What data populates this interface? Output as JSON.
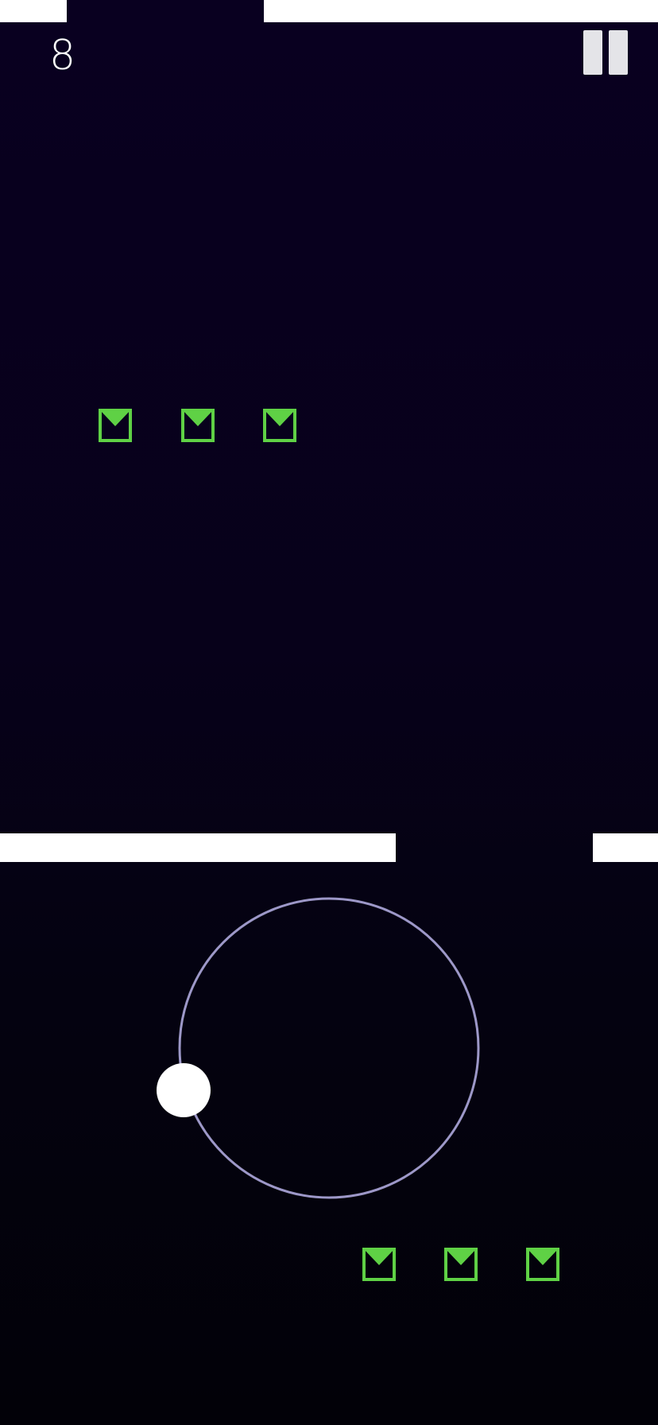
{
  "hud": {
    "score": "8",
    "pause_icon": "pause-icon"
  },
  "colors": {
    "background_top": "#090020",
    "background_bottom": "#020108",
    "wall": "#ffffff",
    "coin": "#5fd145",
    "orbit": "#9d98c8",
    "ball": "#ffffff"
  },
  "collectibles": {
    "icon": "envelope-coin-icon",
    "upper_row_count": 3,
    "lower_row_count": 3
  }
}
